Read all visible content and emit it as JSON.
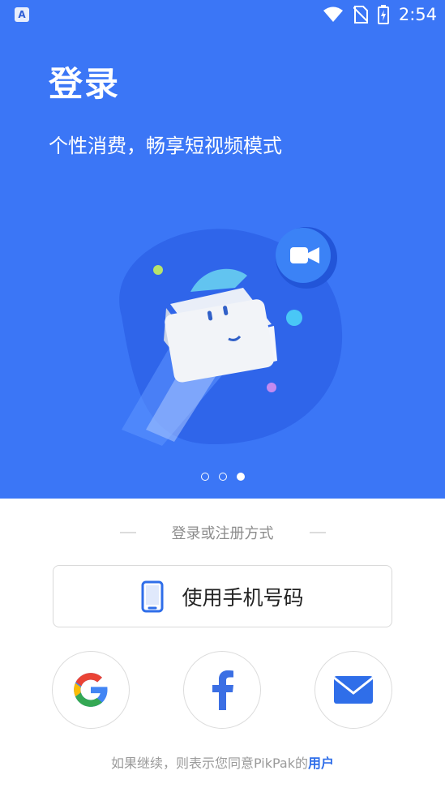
{
  "status_bar": {
    "notification_icon": "a-app-icon",
    "time": "2:54"
  },
  "hero": {
    "title": "登录",
    "subtitle": "个性消费，畅享短视频模式",
    "pager": {
      "count": 3,
      "active": 3
    }
  },
  "login": {
    "section_label": "登录或注册方式",
    "phone_button_label": "使用手机号码",
    "social_buttons": [
      "google",
      "facebook",
      "email"
    ]
  },
  "legal": {
    "text": "如果继续，则表示您同意PikPak的",
    "link": "用户"
  },
  "colors": {
    "brand_blue": "#3b76f6",
    "link_blue": "#2f6ee9",
    "google_blue": "#4285F4",
    "google_red": "#EA4335",
    "google_yellow": "#FBBC05",
    "google_green": "#34A853"
  }
}
